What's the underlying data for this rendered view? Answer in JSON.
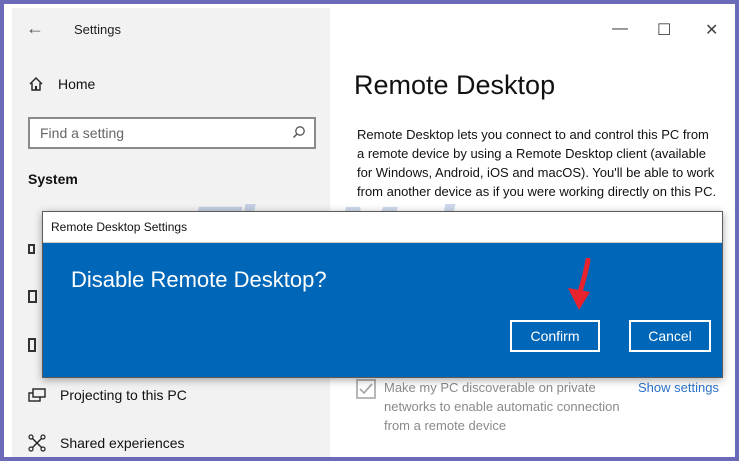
{
  "window": {
    "app_title": "Settings",
    "controls": {
      "minimize": "—",
      "maximize": "☐",
      "close": "✕"
    }
  },
  "sidebar": {
    "home_label": "Home",
    "search_placeholder": "Find a setting",
    "section_label": "System",
    "items": [
      {
        "label": "Projecting to this PC",
        "icon": "projector-icon"
      },
      {
        "label": "Shared experiences",
        "icon": "shared-experiences-icon"
      }
    ]
  },
  "main": {
    "page_title": "Remote Desktop",
    "description": "Remote Desktop lets you connect to and control this PC from a remote device by using a Remote Desktop client (available for Windows, Android, iOS and macOS). You'll be able to work from another device as if you were working directly on this PC.",
    "discoverable_checkbox": {
      "label": "Make my PC discoverable on private networks to enable automatic connection from a remote device",
      "checked": true
    },
    "show_settings_link": "Show settings"
  },
  "dialog": {
    "window_title": "Remote Desktop Settings",
    "heading": "Disable Remote Desktop?",
    "confirm_label": "Confirm",
    "cancel_label": "Cancel",
    "accent_color": "#0067b8"
  },
  "watermark": {
    "text": "TipsMake",
    "suffix": ".com"
  }
}
